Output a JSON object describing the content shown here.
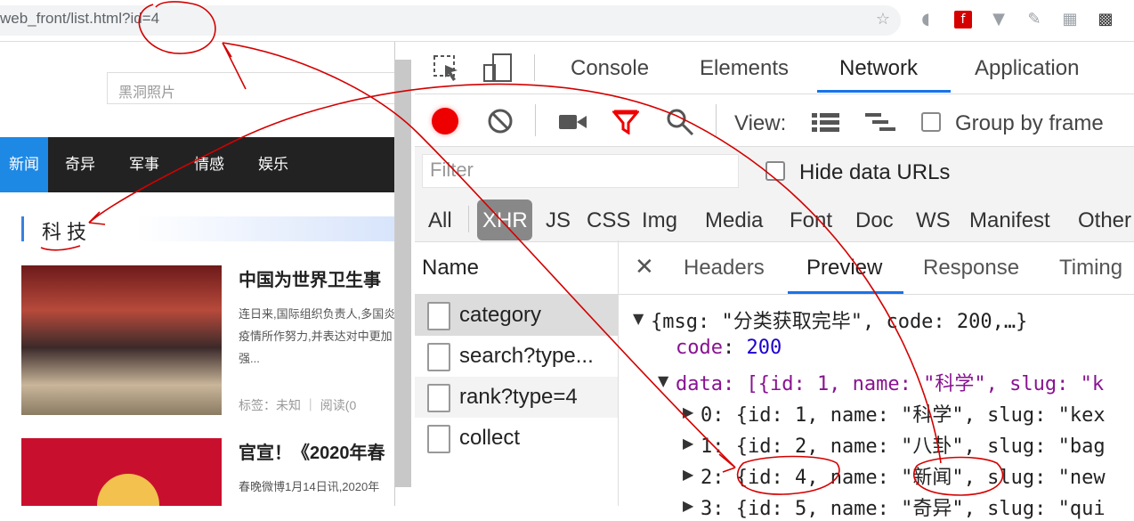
{
  "address_bar": {
    "url": "web_front/list.html?id=4"
  },
  "page": {
    "search_placeholder": "黑洞照片",
    "nav": [
      "新闻",
      "奇异",
      "军事",
      "情感",
      "娱乐"
    ],
    "category_title": "科技",
    "articles": [
      {
        "title": "中国为世界卫生事",
        "desc": "连日来,国际组织负责人,多国炎疫情所作努力,并表达对中更加强...",
        "meta": "标签：未知 ｜ 阅读(0"
      },
      {
        "title": "官宣！《2020年春",
        "desc": "春晚微博1月14日讯,2020年"
      }
    ]
  },
  "devtools": {
    "main_tabs": [
      "Console",
      "Elements",
      "Network",
      "Application"
    ],
    "view_label": "View:",
    "group_by_frame": "Group by frame",
    "filter_placeholder": "Filter",
    "hide_data_urls": "Hide data URLs",
    "filter_types": [
      "All",
      "XHR",
      "JS",
      "CSS",
      "Img",
      "Media",
      "Font",
      "Doc",
      "WS",
      "Manifest",
      "Other"
    ],
    "name_header": "Name",
    "requests": [
      "category",
      "search?type...",
      "rank?type=4",
      "collect"
    ],
    "detail_tabs": [
      "Headers",
      "Preview",
      "Response",
      "Timing"
    ],
    "preview": {
      "root": "{msg: \"分类获取完毕\", code: 200,…}",
      "code_key": "code",
      "code_val": "200",
      "data_line": "data: [{id: 1, name: \"科学\", slug: \"k",
      "items": [
        "0: {id: 1, name: \"科学\", slug: \"kex",
        "1: {id: 2, name: \"八卦\", slug: \"bag",
        "2: {id: 4, name: \"新闻\", slug: \"new",
        "3: {id: 5, name: \"奇异\", slug: \"qui"
      ]
    }
  },
  "colors": {
    "accent": "#1a73e8",
    "annotation": "#d40000",
    "active_nav": "#1e88e5"
  }
}
